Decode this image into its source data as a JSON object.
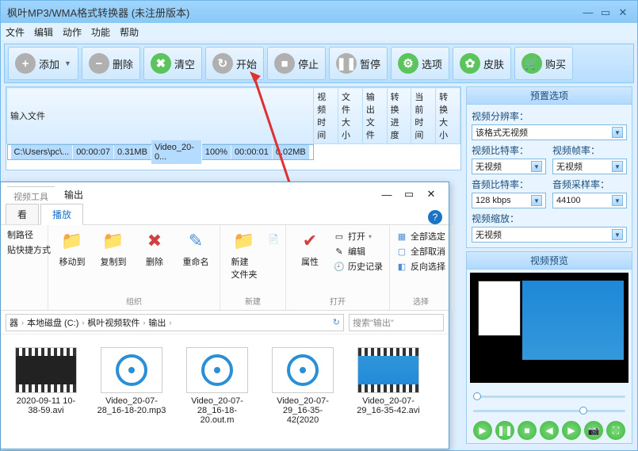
{
  "window": {
    "title": "枫叶MP3/WMA格式转换器   (未注册版本)"
  },
  "menu": [
    "文件",
    "编辑",
    "动作",
    "功能",
    "帮助"
  ],
  "toolbar": {
    "add": "添加",
    "delete": "删除",
    "clear": "清空",
    "start": "开始",
    "stop": "停止",
    "pause": "暂停",
    "options": "选项",
    "skin": "皮肤",
    "buy": "购买"
  },
  "grid": {
    "headers": [
      "输入文件",
      "视频时间",
      "文件大小",
      "输出文件",
      "转换进度",
      "当前时间",
      "转换大小"
    ],
    "rows": [
      {
        "in": "C:\\Users\\pc\\...",
        "vtime": "00:00:07",
        "size": "0.31MB",
        "out": "Video_20-0...",
        "prog": "100%",
        "ctime": "00:00:01",
        "csize": "0.02MB"
      }
    ]
  },
  "preset": {
    "title": "预置选项",
    "res_lbl": "视频分辨率：",
    "res_val": "该格式无视频",
    "vbit_lbl": "视频比特率：",
    "vbit_val": "无视频",
    "vfps_lbl": "视频帧率：",
    "vfps_val": "无视频",
    "abit_lbl": "音频比特率：",
    "abit_val": "128 kbps",
    "asmp_lbl": "音频采样率：",
    "asmp_val": "44100",
    "vscale_lbl": "视频缩放：",
    "vscale_val": "无视频"
  },
  "preview": {
    "title": "视频预览"
  },
  "explorer": {
    "tool_tab": "视频工具",
    "title": "输出",
    "tabs": {
      "view": "看",
      "play": "播放"
    },
    "side": {
      "copy_path": "制路径",
      "paste_shortcut": "贴快捷方式"
    },
    "ribbon": {
      "move": "移动到",
      "copy": "复制到",
      "delete": "删除",
      "rename": "重命名",
      "new_folder": "新建\n文件夹",
      "properties": "属性",
      "open": "打开",
      "edit": "编辑",
      "history": "历史记录",
      "select_all": "全部选定",
      "select_none": "全部取消",
      "invert": "反向选择",
      "g_org": "组织",
      "g_new": "新建",
      "g_open": "打开",
      "g_sel": "选择"
    },
    "addr": {
      "p1": "器",
      "p2": "本地磁盘 (C:)",
      "p3": "枫叶视频软件",
      "p4": "输出",
      "search": "搜索\"输出\""
    },
    "files": [
      {
        "name": "2020-09-11 10-38-59.avi",
        "kind": "dark"
      },
      {
        "name": "Video_20-07-28_16-18-20.mp3",
        "kind": "audio"
      },
      {
        "name": "Video_20-07-28_16-18-20.out.m",
        "kind": "audio"
      },
      {
        "name": "Video_20-07-29_16-35-42(2020",
        "kind": "audio"
      },
      {
        "name": "Video_20-07-29_16-35-42.avi",
        "kind": "blue"
      }
    ]
  }
}
